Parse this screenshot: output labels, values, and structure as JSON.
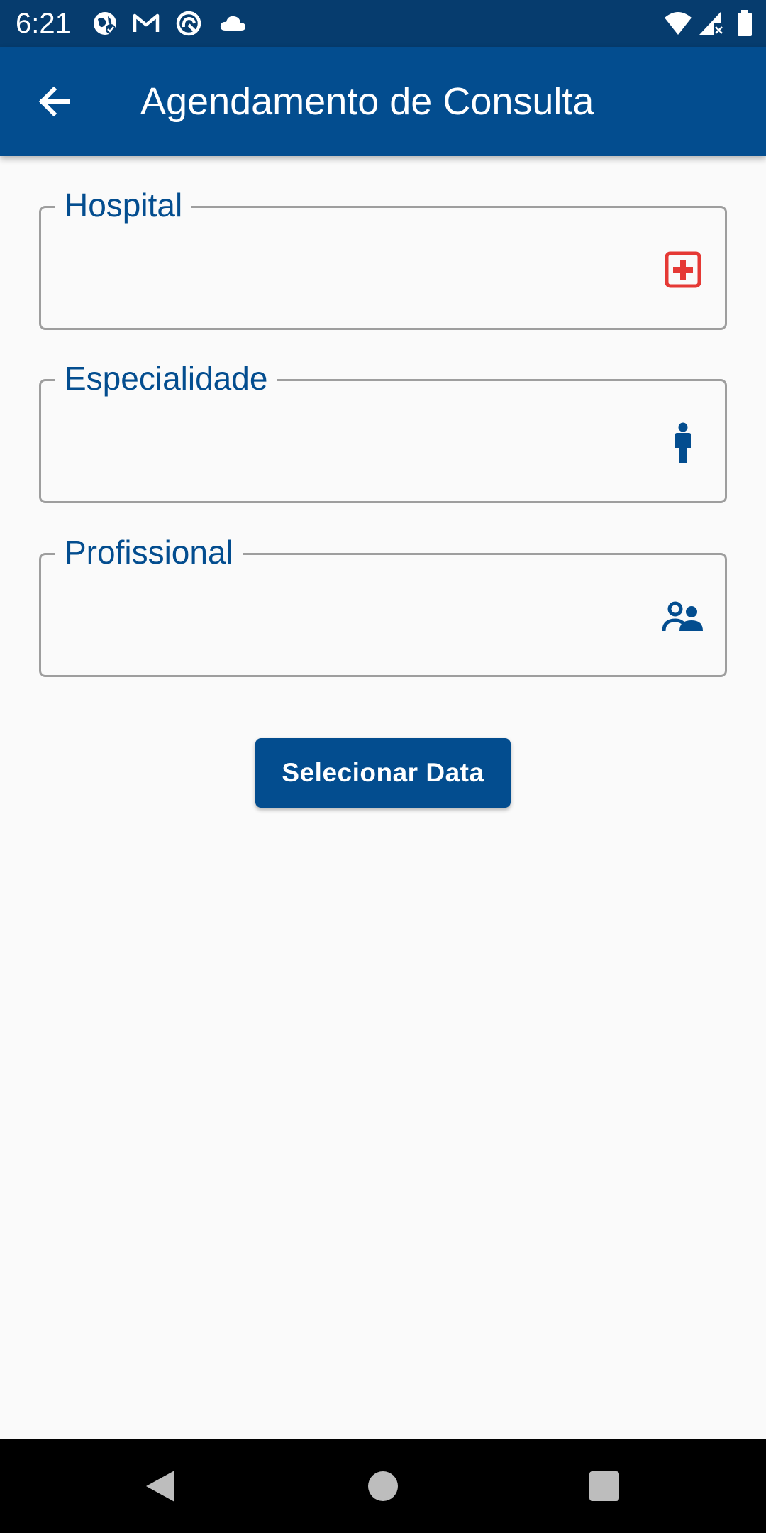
{
  "status_bar": {
    "time": "6:21",
    "left_icons": [
      "vpn-globe-icon",
      "gmail-icon",
      "sync-icon",
      "cloud-icon"
    ],
    "right_icons": [
      "wifi-icon",
      "signal-icon",
      "battery-icon"
    ]
  },
  "app_bar": {
    "back_icon": "arrow-back-icon",
    "title": "Agendamento de Consulta"
  },
  "form": {
    "hospital": {
      "label": "Hospital",
      "value": "",
      "icon": "hospital-cross-icon"
    },
    "especialidade": {
      "label": "Especialidade",
      "value": "",
      "icon": "person-icon"
    },
    "profissional": {
      "label": "Profissional",
      "value": "",
      "icon": "people-icon"
    }
  },
  "actions": {
    "select_date_label": "Selecionar Data"
  },
  "nav_bar": {
    "icons": [
      "nav-back-icon",
      "nav-home-icon",
      "nav-recents-icon"
    ]
  },
  "colors": {
    "status_bar": "#063c6e",
    "app_bar": "#034d8f",
    "label": "#034d8f",
    "hospital_icon": "#e53935",
    "field_border": "#9e9e9e",
    "background": "#fafafa"
  }
}
